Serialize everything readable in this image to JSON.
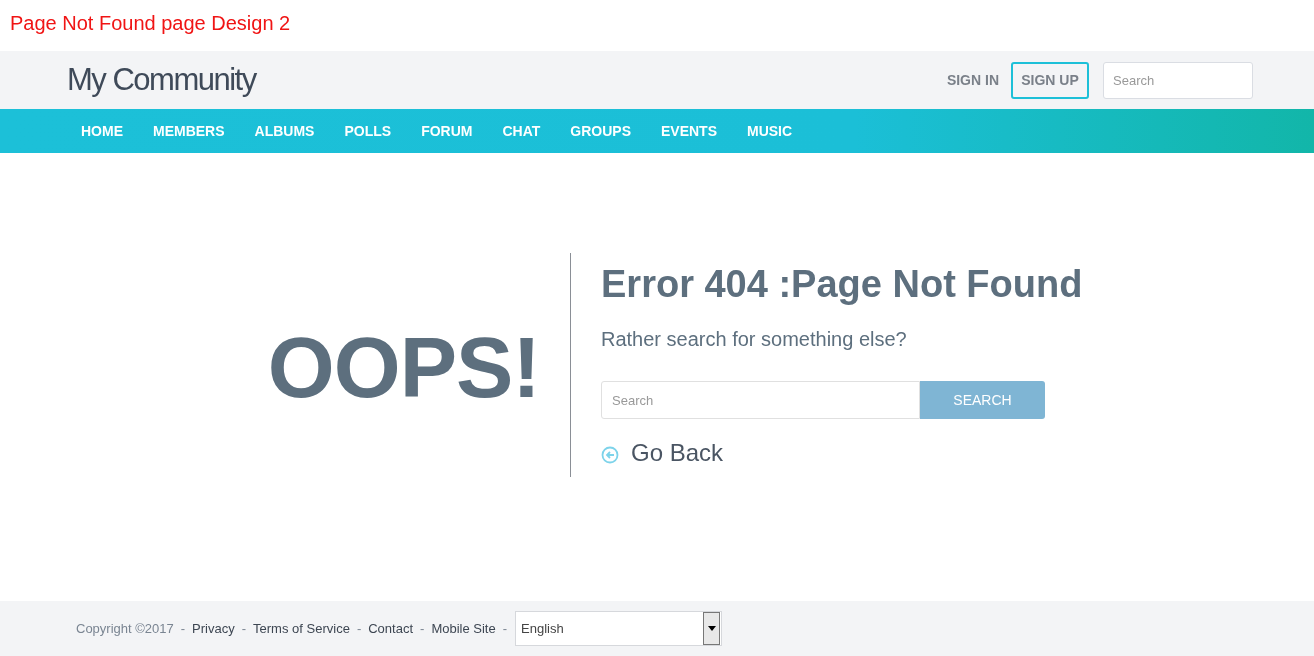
{
  "caption": "Page Not Found page Design 2",
  "header": {
    "logo": "My Community",
    "sign_in": "SIGN IN",
    "sign_up": "SIGN UP",
    "search": {
      "placeholder": "Search"
    }
  },
  "nav": {
    "items": [
      "HOME",
      "MEMBERS",
      "ALBUMS",
      "POLLS",
      "FORUM",
      "CHAT",
      "GROUPS",
      "EVENTS",
      "MUSIC"
    ]
  },
  "main": {
    "oops": "OOPS!",
    "title": "Error 404 :Page Not Found",
    "subtitle": "Rather search for something else?",
    "search": {
      "placeholder": "Search"
    },
    "search_button": "SEARCH",
    "go_back": "Go Back"
  },
  "footer": {
    "copyright": "Copyright ©2017",
    "separator": "-",
    "links": [
      "Privacy",
      "Terms of Service",
      "Contact",
      "Mobile Site"
    ],
    "language": "English"
  }
}
